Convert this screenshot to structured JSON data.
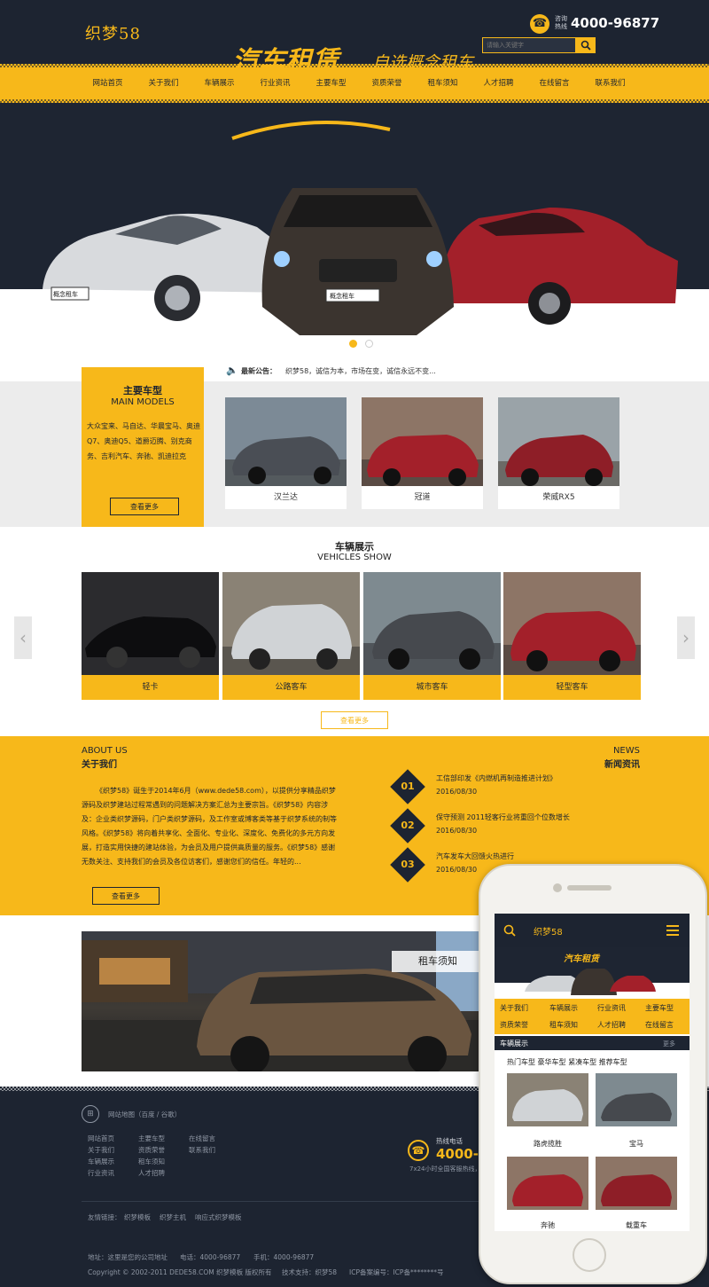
{
  "header": {
    "logo": "织梦58",
    "hotline_label": "咨询热线",
    "hotline": "4000-96877",
    "search_placeholder": "请输入关键字"
  },
  "nav": [
    "网站首页",
    "关于我们",
    "车辆展示",
    "行业资讯",
    "主要车型",
    "资质荣誉",
    "租车须知",
    "人才招聘",
    "在线留言",
    "联系我们"
  ],
  "banner": {
    "title": "汽车租赁",
    "subtitle": "自选概念租车",
    "plate_left": "概念租车",
    "plate_center": "概念租车"
  },
  "notice": {
    "label": "最新公告：",
    "text": "织梦58，诚信为本，市场在变，诚信永远不变..."
  },
  "main_models": {
    "title": "主要车型",
    "title_en": "MAIN MODELS",
    "description": "大众宝来、马自达、华晨宝马、奥迪Q7、奥迪Q5、道爵迈腾、别克商务、吉利汽车、奔驰、凯迪拉克",
    "more": "查看更多",
    "cards": [
      "汉兰达",
      "冠道",
      "荣威RX5"
    ]
  },
  "vehicles_show": {
    "title": "车辆展示",
    "title_en": "VEHICLES SHOW",
    "cards": [
      "轻卡",
      "公路客车",
      "城市客车",
      "轻型客车"
    ],
    "more": "查看更多"
  },
  "about": {
    "title_en": "ABOUT US",
    "title": "关于我们",
    "text": "《织梦58》诞生于2014年6月（www.dede58.com），以提供分享精品织梦源码及织梦建站过程常遇到的问题解决方案汇总为主要宗旨。《织梦58》内容涉及：企业类织梦源码，门户类织梦源码，及工作室或博客类等基于织梦系统的制等风格。《织梦58》将向着共享化、全面化、专业化、深度化、免费化的多元方向发展，打造实用快捷的建站体验，为会员及用户提供高质量的服务。《织梦58》感谢无数关注、支持我们的会员及各位访客们，感谢您们的信任。年轻的...",
    "more": "查看更多"
  },
  "news": {
    "title_en": "NEWS",
    "title": "新闻资讯",
    "items": [
      {
        "num": "01",
        "title": "工信部印发《内燃机再制造推进计划》",
        "date": "2016/08/30"
      },
      {
        "num": "02",
        "title": "保守预测 2011轻客行业将重回个位数增长",
        "date": "2016/08/30"
      },
      {
        "num": "03",
        "title": "汽车发车大回馈火热进行",
        "date": "2016/08/30"
      }
    ]
  },
  "rent_banner": {
    "label": "租车须知"
  },
  "footer": {
    "sitemap": "网站地图（百度 / 谷歌）",
    "links_col1": [
      "网站首页",
      "关于我们",
      "车辆展示",
      "行业资讯"
    ],
    "links_col2": [
      "主要车型",
      "资质荣誉",
      "租车须知",
      "人才招聘"
    ],
    "links_col3": [
      "在线留言",
      "联系我们"
    ],
    "hotline_label": "热线电话",
    "hotline": "4000-96",
    "hotline_sub": "7x24小时全国客服热线，",
    "friend_label": "友情链接：",
    "friend_links": [
      "织梦模板",
      "织梦主机",
      "响应式织梦模板"
    ],
    "address": "地址：这里是您的公司地址",
    "phone": "电话：4000-96877",
    "mobile": "手机：4000-96877",
    "copyright": "Copyright © 2002-2011 DEDE58.COM 织梦模板 版权所有",
    "support": "技术支持：织梦58",
    "icp": "ICP备案编号：ICP备********号"
  },
  "mobile": {
    "logo": "织梦58",
    "banner_title": "汽车租赁",
    "menu": [
      "关于我们",
      "车辆展示",
      "行业资讯",
      "主要车型",
      "资质荣誉",
      "租车须知",
      "人才招聘",
      "在线留言"
    ],
    "section": "车辆展示",
    "section_more": "更多",
    "tabs": "热门车型 豪华车型 紧凑车型 推荐车型",
    "cards": [
      "路虎揽胜",
      "宝马",
      "奔驰",
      "载重车"
    ]
  },
  "colors": {
    "accent": "#f7b81a",
    "dark": "#1d2431",
    "red_car": "#a3202a"
  }
}
